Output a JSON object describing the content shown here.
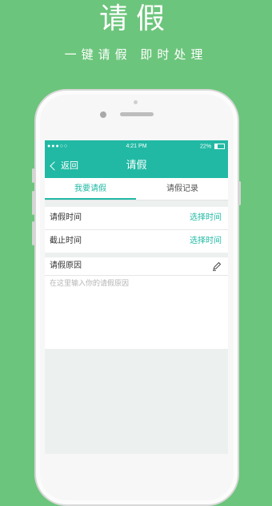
{
  "promo": {
    "title": "请假",
    "subtitle": "一键请假 即时处理"
  },
  "status_bar": {
    "carrier": "●●●○○",
    "time": "4:21 PM",
    "battery": "22%"
  },
  "nav": {
    "back_label": "返回",
    "title": "请假"
  },
  "tabs": [
    {
      "label": "我要请假",
      "active": true
    },
    {
      "label": "请假记录",
      "active": false
    }
  ],
  "form": {
    "start_label": "请假时间",
    "start_value": "选择时间",
    "end_label": "截止时间",
    "end_value": "选择时间",
    "reason_label": "请假原因",
    "reason_placeholder": "在这里输入你的请假原因"
  },
  "colors": {
    "background": "#6cc57c",
    "accent": "#21b9a4"
  }
}
